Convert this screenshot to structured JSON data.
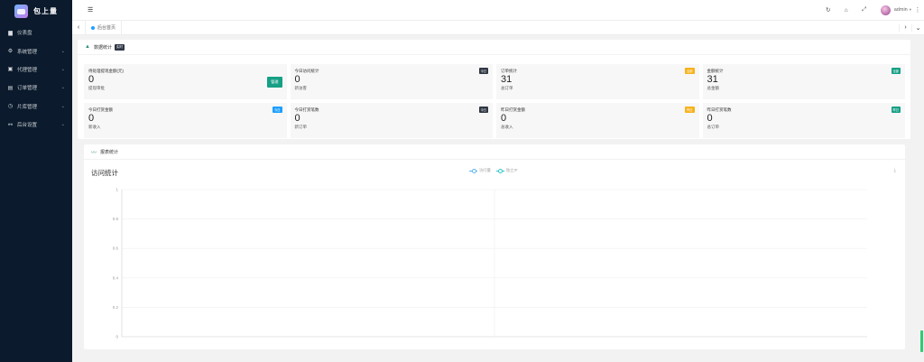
{
  "sidebar": {
    "logo_text": "包上量",
    "items": [
      {
        "icon": "dashboard-icon",
        "glyph": "▆",
        "label": "仪表盘",
        "arrow": ""
      },
      {
        "icon": "system-icon",
        "glyph": "⚙",
        "label": "系统管理",
        "arrow": "⌄"
      },
      {
        "icon": "agent-icon",
        "glyph": "▣",
        "label": "代理管理",
        "arrow": "⌄"
      },
      {
        "icon": "order-icon",
        "glyph": "▤",
        "label": "订单管理",
        "arrow": "⌄"
      },
      {
        "icon": "slice-icon",
        "glyph": "◷",
        "label": "片库管理",
        "arrow": "⌄"
      },
      {
        "icon": "settings-icon",
        "glyph": "⚯",
        "label": "后台设置",
        "arrow": "⌄"
      }
    ]
  },
  "header": {
    "toggle_glyph": "☰",
    "refresh_glyph": "↻",
    "lock_glyph": "⌂",
    "fullscreen_glyph": "⤢",
    "user_name": "admin",
    "caret": "▾",
    "more_glyph": "⋮"
  },
  "tabs": {
    "left_arrow": "‹",
    "right_arrow": "›",
    "down_arrow": "⌄",
    "active_label": "后台首页"
  },
  "stats_card": {
    "title": "数据统计",
    "title_badge": "实时",
    "items": [
      {
        "title": "待处理提现金额(元)",
        "value": "0",
        "sub": "提现审批",
        "badge": "",
        "badge_color": "",
        "button": "管理"
      },
      {
        "title": "今日访问统计",
        "value": "0",
        "sub": "新访客",
        "badge": "今日",
        "badge_color": "#2f3744",
        "button": ""
      },
      {
        "title": "订单统计",
        "value": "31",
        "sub": "总订单",
        "badge": "全部",
        "badge_color": "#f7b21c",
        "button": ""
      },
      {
        "title": "金额统计",
        "value": "31",
        "sub": "总金额",
        "badge": "全部",
        "badge_color": "#16a085",
        "button": ""
      },
      {
        "title": "今日打赏金额",
        "value": "0",
        "sub": "新收入",
        "badge": "今日",
        "badge_color": "#1e9fff",
        "button": ""
      },
      {
        "title": "今日打赏笔数",
        "value": "0",
        "sub": "新订单",
        "badge": "今日",
        "badge_color": "#2f3744",
        "button": ""
      },
      {
        "title": "昨日打赏金额",
        "value": "0",
        "sub": "总收入",
        "badge": "昨日",
        "badge_color": "#f7b21c",
        "button": ""
      },
      {
        "title": "昨日打赏笔数",
        "value": "0",
        "sub": "总订单",
        "badge": "昨日",
        "badge_color": "#16a085",
        "button": ""
      }
    ]
  },
  "chart_card": {
    "title": "报表统计",
    "download_glyph": "⤓"
  },
  "chart_data": {
    "type": "line",
    "title": "访问统计",
    "series": [
      {
        "name": "访问量",
        "values": [],
        "color": "#5ab1ef"
      },
      {
        "name": "独立IP",
        "values": [],
        "color": "#2ec7c9"
      }
    ],
    "yticks": [
      "1",
      "0.8",
      "0.6",
      "0.4",
      "0.2",
      "0"
    ],
    "ylim": [
      0,
      1
    ],
    "grid": true,
    "legend_position": "top-center"
  }
}
